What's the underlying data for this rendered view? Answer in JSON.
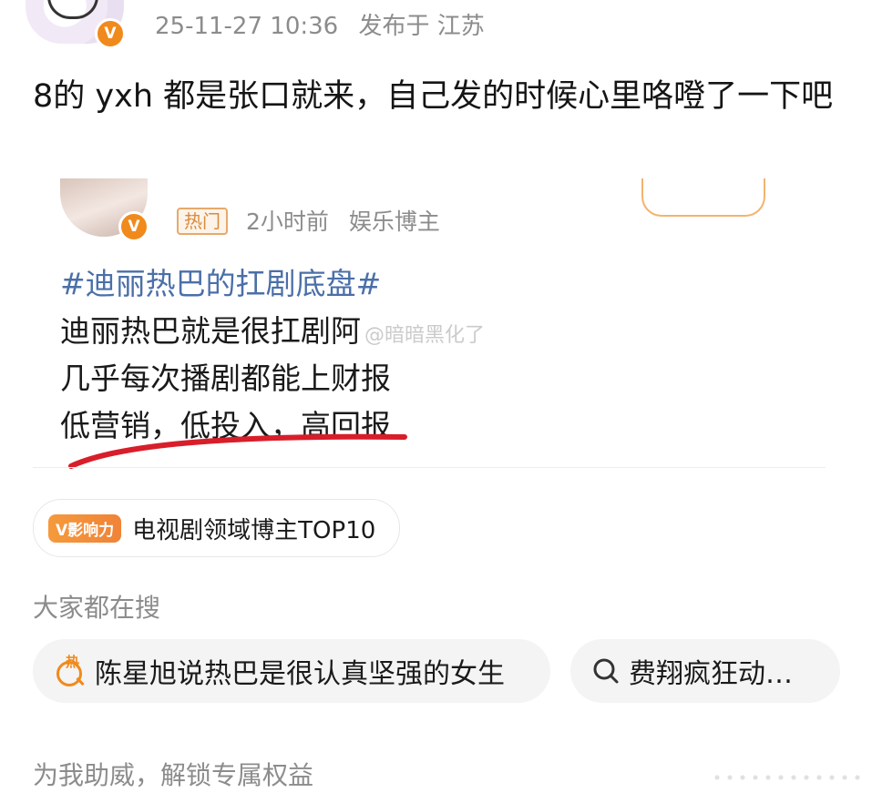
{
  "post": {
    "timestamp": "25-11-27 10:36",
    "location": "发布于 江苏",
    "text": "8的 yxh 都是张口就来，自己发的时候心里咯噔了一下吧"
  },
  "quoted": {
    "hot_tag": "热门",
    "time_ago": "2小时前",
    "author_type": "娱乐博主",
    "hashtag": "#迪丽热巴的扛剧底盘#",
    "lines": [
      "迪丽热巴就是很扛剧阿",
      "几乎每次播剧都能上财报",
      "低营销，低投入，高回报"
    ],
    "watermark": "@暗暗黑化了"
  },
  "influence": {
    "badge": "V影响力",
    "text": "电视剧领域博主TOP10"
  },
  "search": {
    "title": "大家都在搜",
    "hot_icon_label": "热",
    "chips": [
      "陈星旭说热巴是很认真坚强的女生",
      "费翔疯狂动…"
    ]
  },
  "footer": {
    "text": "为我助威，解锁专属权益"
  },
  "colors": {
    "accent_orange": "#f08a1c",
    "hashtag_blue": "#4b6fa8",
    "underline_red": "#d81e2a"
  }
}
